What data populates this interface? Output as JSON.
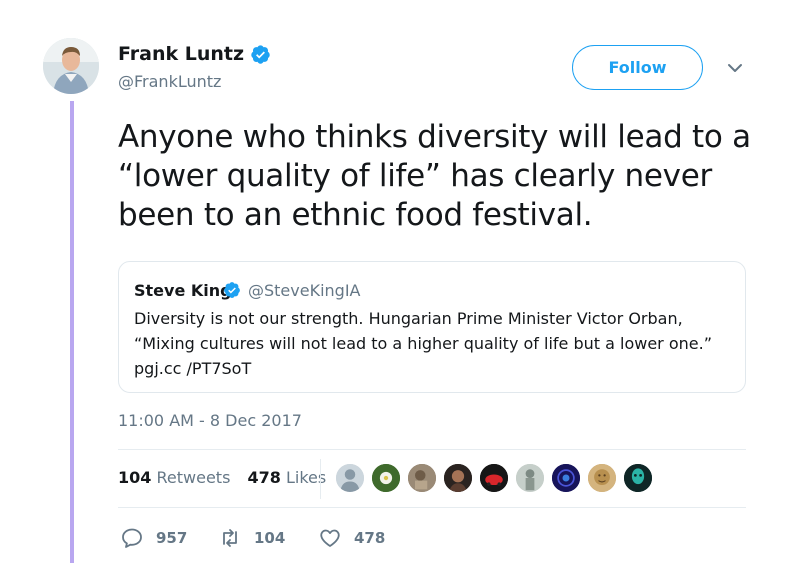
{
  "author": {
    "name": "Frank Luntz",
    "handle": "@FrankLuntz",
    "verified": true
  },
  "follow_label": "Follow",
  "tweet_text": "Anyone who thinks diversity will lead to a “lower quality of life” has clearly never been to an ethnic food festival.",
  "quoted": {
    "name": "Steve King",
    "handle": "@SteveKingIA",
    "verified": true,
    "text": "Diversity is not our strength. Hungarian Prime Minister Victor Orban, “Mixing cultures will not lead to a higher quality of life but a lower one.” pgj.cc /PT7SoT"
  },
  "timestamp": "11:00 AM - 8 Dec 2017",
  "stats": {
    "retweets_count": "104",
    "retweets_label": "Retweets",
    "likes_count": "478",
    "likes_label": "Likes"
  },
  "actions": {
    "replies": "957",
    "retweets": "104",
    "likes": "478"
  },
  "colors": {
    "accent": "#1da1f2",
    "thread_line": "#b9a7f0",
    "muted": "#657786"
  },
  "liker_avatars": [
    "default-avatar",
    "flower-avatar",
    "sculpture-avatar",
    "person-avatar",
    "red-car-avatar",
    "statue-avatar",
    "blue-pattern-avatar",
    "gold-face-avatar",
    "teal-figure-avatar"
  ]
}
